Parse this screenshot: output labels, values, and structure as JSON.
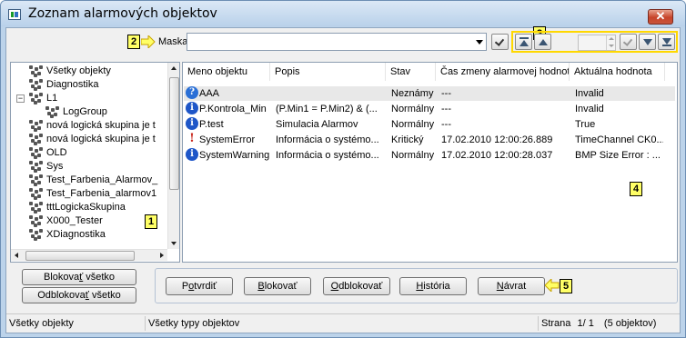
{
  "window": {
    "title": "Zoznam alarmových objektov",
    "close_glyph": "✕"
  },
  "callouts": {
    "c1": "1",
    "c2": "2",
    "c3": "3",
    "c4": "4",
    "c5": "5"
  },
  "mask": {
    "label": "Maska:",
    "value": ""
  },
  "tree": {
    "items": [
      {
        "label": "Všetky objekty",
        "level": 0
      },
      {
        "label": "Diagnostika",
        "level": 0
      },
      {
        "label": "L1",
        "level": 0,
        "expander": "−"
      },
      {
        "label": "LogGroup",
        "level": 1
      },
      {
        "label": "nová logická skupina je t",
        "level": 0
      },
      {
        "label": "nová logická skupina je t",
        "level": 0
      },
      {
        "label": "OLD",
        "level": 0
      },
      {
        "label": "Sys",
        "level": 0
      },
      {
        "label": "Test_Farbenia_Alarmov_",
        "level": 0
      },
      {
        "label": "Test_Farbenia_alarmov1",
        "level": 0
      },
      {
        "label": "tttLogickaSkupina",
        "level": 0
      },
      {
        "label": "X000_Tester",
        "level": 0
      },
      {
        "label": "XDiagnostika",
        "level": 0
      }
    ]
  },
  "table": {
    "columns": [
      "Meno objektu",
      "Popis",
      "Stav",
      "Čas zmeny alarmovej hodnoty",
      "Aktuálna hodnota"
    ],
    "rows": [
      {
        "icon": "question-icon",
        "icon_glyph": "?",
        "icon_color": "#2a6fd6",
        "name": "AAA",
        "desc": "",
        "state": "Neznámy",
        "time": "---",
        "value": "Invalid"
      },
      {
        "icon": "info-icon",
        "icon_glyph": "i",
        "icon_color": "#1e56c8",
        "name": "P.Kontrola_Min",
        "desc": "(P.Min1 = P.Min2) & (...",
        "state": "Normálny",
        "time": "---",
        "value": "Invalid"
      },
      {
        "icon": "info-icon",
        "icon_glyph": "i",
        "icon_color": "#1e56c8",
        "name": "P.test",
        "desc": "Simulacia Alarmov",
        "state": "Normálny",
        "time": "---",
        "value": "True"
      },
      {
        "icon": "critical-alarm-icon",
        "icon_glyph": "!",
        "icon_color": "#c8281e",
        "name": "SystemError",
        "desc": "Informácia o systémo...",
        "state": "Kritický",
        "time": "17.02.2010 12:00:26.889",
        "value": "TimeChannel CK0..."
      },
      {
        "icon": "info-icon",
        "icon_glyph": "i",
        "icon_color": "#1e56c8",
        "name": "SystemWarning",
        "desc": "Informácia o systémo...",
        "state": "Normálny",
        "time": "17.02.2010 12:00:28.037",
        "value": "BMP Size Error : ..."
      }
    ]
  },
  "buttons": {
    "block_all": {
      "pre": "Blokova",
      "u": "ť",
      "post": " všetko"
    },
    "unblock_all": {
      "pre": "Odblokova",
      "u": "ť",
      "post": " všetko"
    },
    "confirm": {
      "pre": "P",
      "u": "o",
      "post": "tvrdiť"
    },
    "block": {
      "pre": "",
      "u": "B",
      "post": "lokovať"
    },
    "unblock": {
      "pre": "",
      "u": "O",
      "post": "dblokovať"
    },
    "history": {
      "pre": "",
      "u": "H",
      "post": "istória"
    },
    "back": {
      "pre": "",
      "u": "N",
      "post": "ávrat"
    }
  },
  "status": {
    "filter_objects": "Všetky objekty",
    "filter_types": "Všetky typy objektov",
    "page_label": "Strana",
    "page_value": "1/ 1",
    "count": "(5 objektov)"
  },
  "colors": {
    "callout_fill": "#ffff66",
    "callout_border": "#ffd800",
    "title_gradient_top": "#dbe8f6",
    "client_bg": "#f0f0f0"
  }
}
